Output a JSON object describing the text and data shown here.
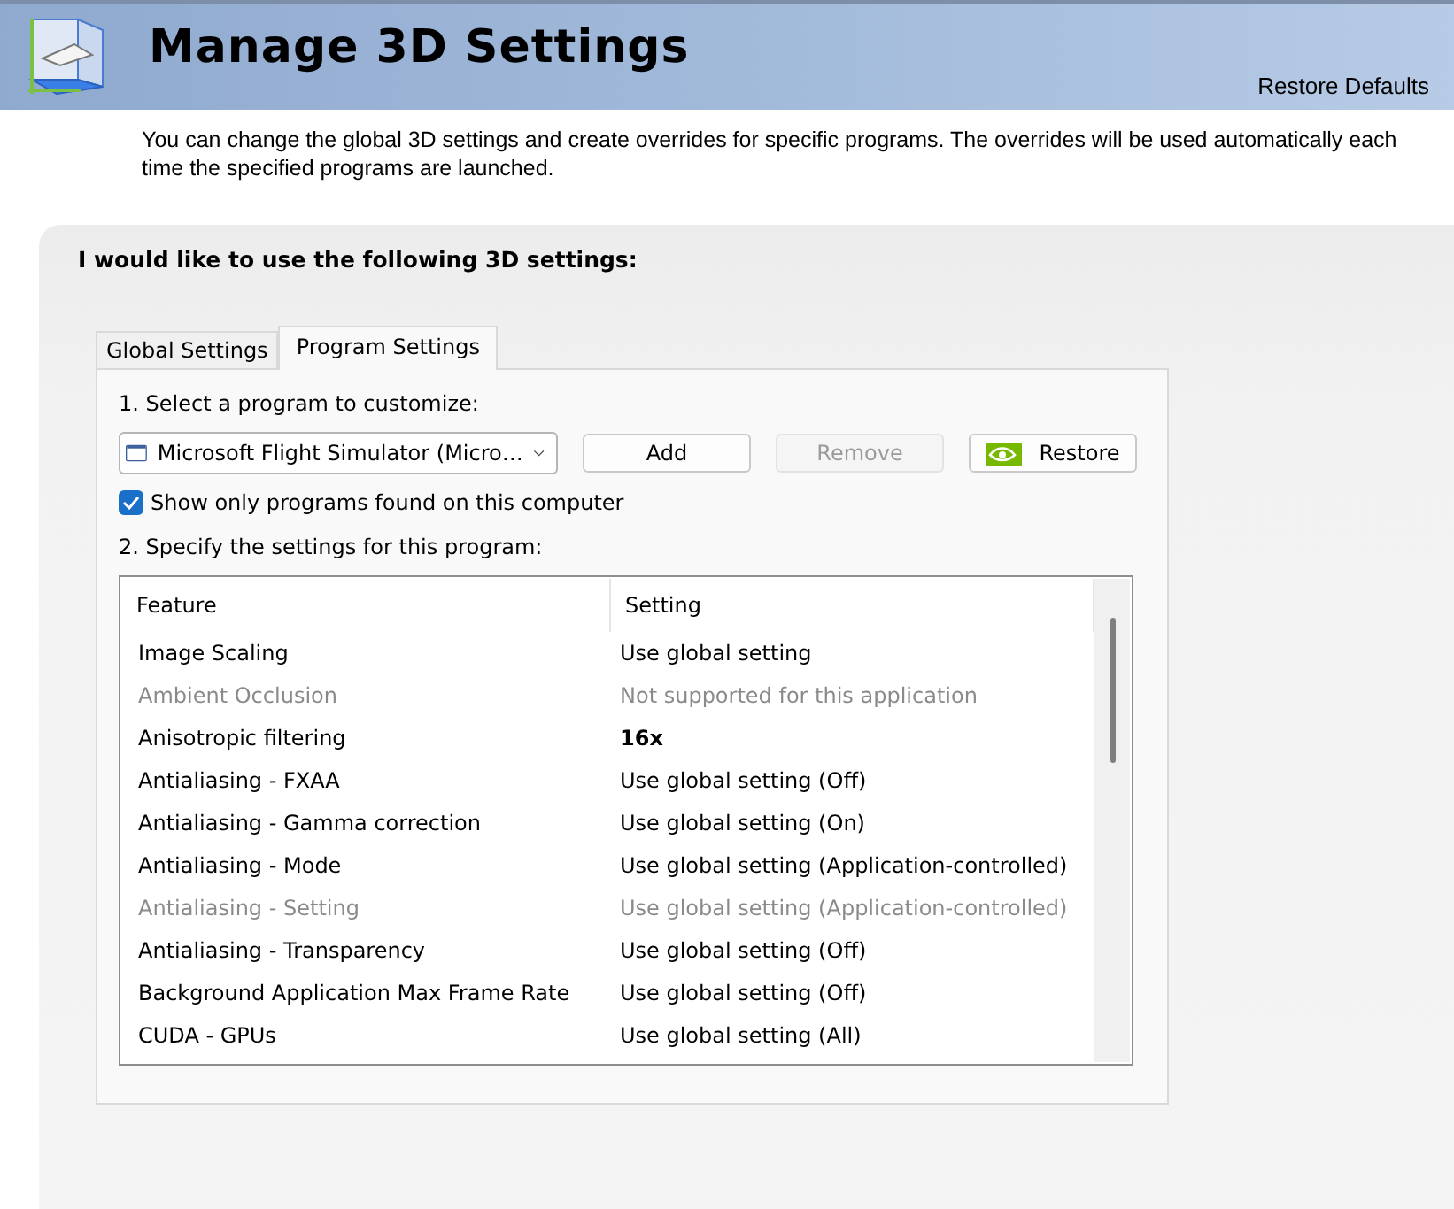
{
  "header": {
    "title": "Manage 3D Settings",
    "restore_link": "Restore Defaults"
  },
  "description": "You can change the global 3D settings and create overrides for specific programs. The overrides will be used automatically each time the specified programs are launched.",
  "section_title": "I would like to use the following 3D settings:",
  "tabs": [
    {
      "label": "Global Settings",
      "selected": false
    },
    {
      "label": "Program Settings",
      "selected": true
    }
  ],
  "program": {
    "step_label": "1. Select a program to customize:",
    "value": "Microsoft Flight Simulator (Micro…",
    "buttons": [
      {
        "label": "Add",
        "disabled": false,
        "kind": "plain"
      },
      {
        "label": "Remove",
        "disabled": true,
        "kind": "plain"
      },
      {
        "label": "Restore",
        "disabled": false,
        "kind": "logo"
      }
    ],
    "show_only_found": {
      "label": "Show only programs found on this computer",
      "checked": true
    }
  },
  "settings": {
    "step_label": "2. Specify the settings for this program:",
    "columns": [
      "Feature",
      "Setting"
    ],
    "rows": [
      {
        "feature": "Image Scaling",
        "setting": "Use global setting",
        "disabled": false,
        "overridden": false
      },
      {
        "feature": "Ambient Occlusion",
        "setting": "Not supported for this application",
        "disabled": true,
        "overridden": false
      },
      {
        "feature": "Anisotropic filtering",
        "setting": "16x",
        "disabled": false,
        "overridden": true
      },
      {
        "feature": "Antialiasing - FXAA",
        "setting": "Use global setting (Off)",
        "disabled": false,
        "overridden": false
      },
      {
        "feature": "Antialiasing - Gamma correction",
        "setting": "Use global setting (On)",
        "disabled": false,
        "overridden": false
      },
      {
        "feature": "Antialiasing - Mode",
        "setting": "Use global setting (Application-controlled)",
        "disabled": false,
        "overridden": false
      },
      {
        "feature": "Antialiasing - Setting",
        "setting": "Use global setting (Application-controlled)",
        "disabled": true,
        "overridden": false
      },
      {
        "feature": "Antialiasing - Transparency",
        "setting": "Use global setting (Off)",
        "disabled": false,
        "overridden": false
      },
      {
        "feature": "Background Application Max Frame Rate",
        "setting": "Use global setting (Off)",
        "disabled": false,
        "overridden": false
      },
      {
        "feature": "CUDA - GPUs",
        "setting": "Use global setting (All)",
        "disabled": false,
        "overridden": false
      }
    ]
  }
}
